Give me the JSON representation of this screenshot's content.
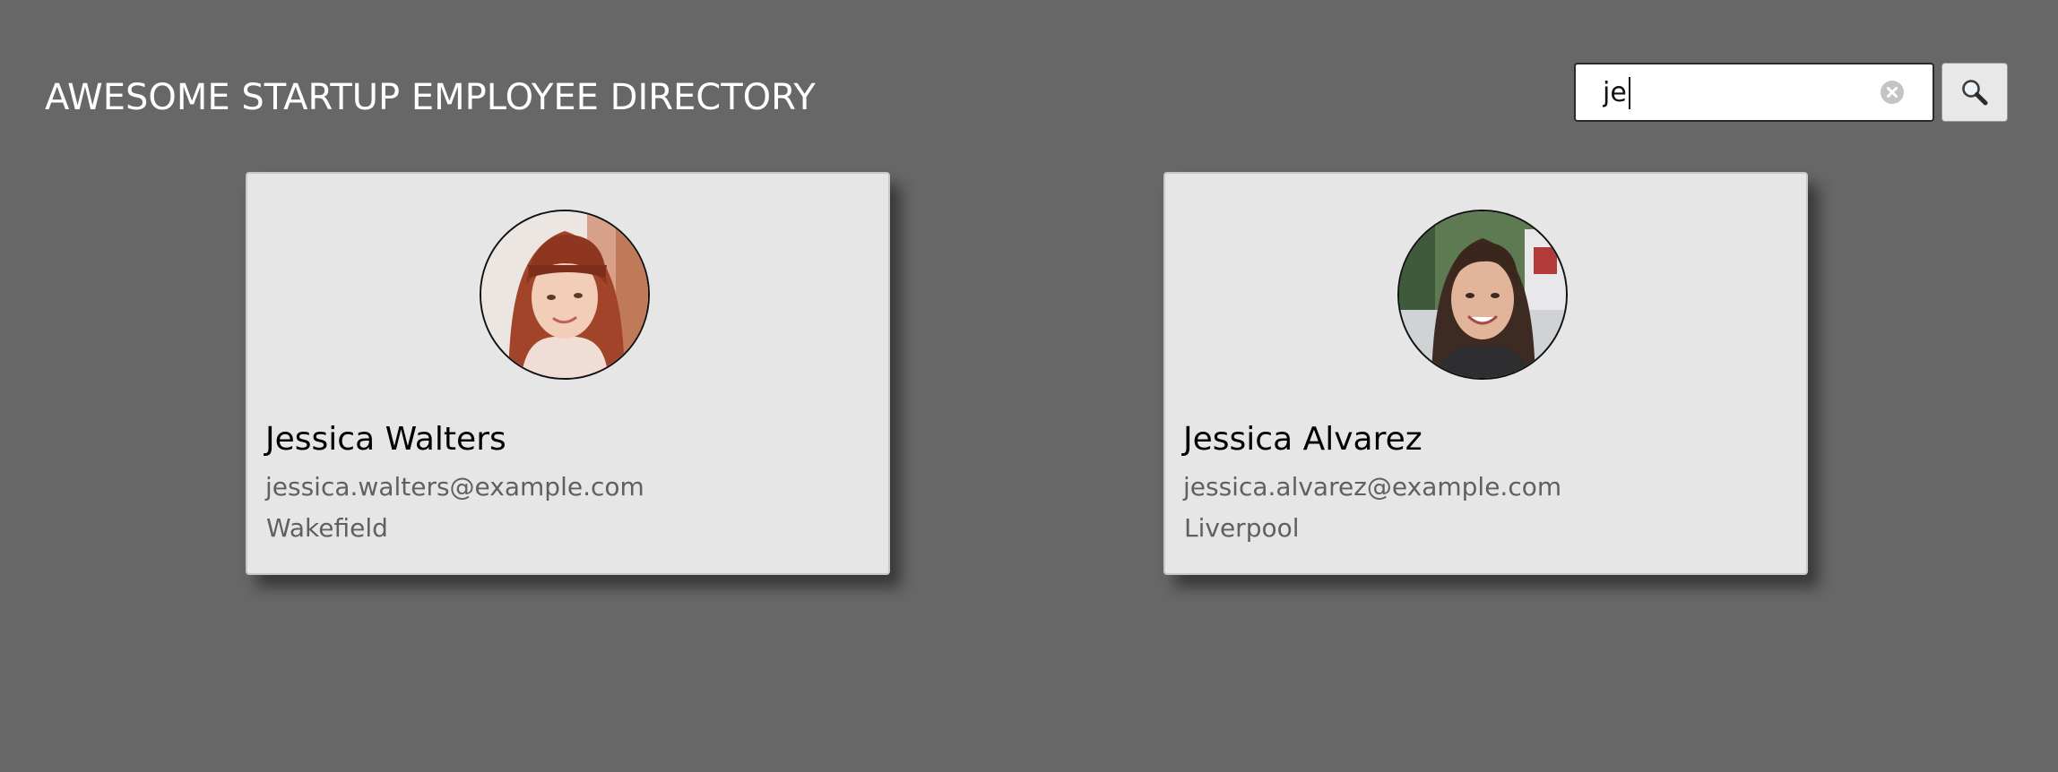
{
  "header": {
    "title": "AWESOME STARTUP EMPLOYEE DIRECTORY"
  },
  "search": {
    "value": "je",
    "clear_icon": "clear-icon",
    "button_icon": "magnifier-icon"
  },
  "employees": [
    {
      "name": "Jessica Walters",
      "email": "jessica.walters@example.com",
      "city": "Wakefield",
      "avatar_icon": "avatar-photo"
    },
    {
      "name": "Jessica Alvarez",
      "email": "jessica.alvarez@example.com",
      "city": "Liverpool",
      "avatar_icon": "avatar-photo"
    }
  ],
  "colors": {
    "background": "#676767",
    "card": "#e6e6e6",
    "title": "#ffffff",
    "secondary_text": "#606060"
  }
}
